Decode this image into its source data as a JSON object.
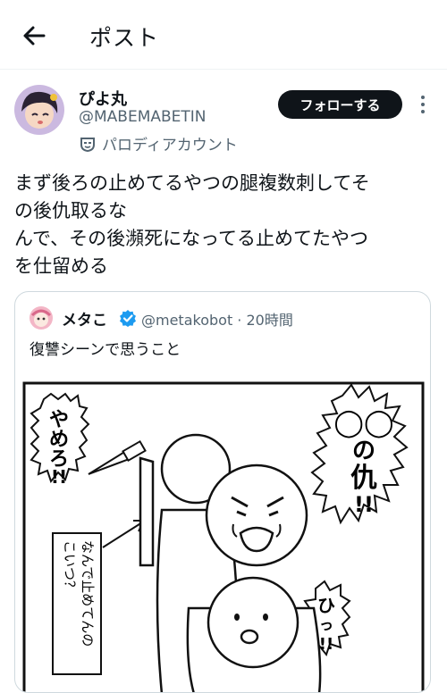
{
  "header": {
    "title": "ポスト",
    "back_icon": "arrow-left-icon"
  },
  "author": {
    "name": "ぴよ丸",
    "handle": "@MABEMABETIN",
    "parody_label": "パロディアカウント",
    "follow_label": "フォローする"
  },
  "tweet": {
    "lines": [
      "まず後ろの止めてるやつの腿複数刺してそ",
      "の後仇取るな",
      "んで、その後瀕死になってる止めてたやつ",
      "を仕留める"
    ]
  },
  "quote": {
    "name": "メタこ",
    "handle_time": "@metakobot · 20時間",
    "text": "復讐シーンで思うこと",
    "comic": {
      "stop": [
        "や",
        "め",
        "ろ",
        "!!"
      ],
      "stop_full": "やめろ!!",
      "revenge": [
        "◯◯",
        "の",
        "仇",
        "!!"
      ],
      "revenge_full": "◯◯の仇!!",
      "why": [
        "なんで止めてんの",
        "こいつ？"
      ],
      "hiii": [
        "ひ",
        "っ",
        "!!"
      ],
      "hiii_full": "ひっ!!"
    }
  },
  "colors": {
    "accent": "#0f1419",
    "secondary": "#536471",
    "verified": "#1d9bf0"
  }
}
